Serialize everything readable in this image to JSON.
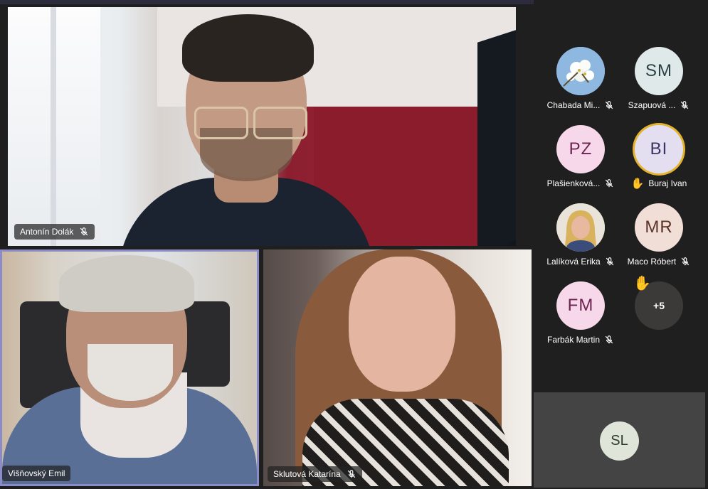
{
  "participants_main": [
    {
      "name": "Antonín Dolák",
      "muted": true
    },
    {
      "name": "Višňovský Emil",
      "muted": false
    },
    {
      "name": "Sklutová Katarína",
      "muted": true
    }
  ],
  "gallery": [
    {
      "initials": "",
      "name": "Chabada Mi...",
      "muted": true,
      "avatar_type": "flower",
      "color": "#9fc6e9"
    },
    {
      "initials": "SM",
      "name": "Szapuová ...",
      "muted": true,
      "color": "#dfe9ea",
      "text_color": "#2b4148"
    },
    {
      "initials": "PZ",
      "name": "Plašienková...",
      "muted": true,
      "color": "#f7d8ea",
      "text_color": "#6b2450"
    },
    {
      "initials": "BI",
      "name": "Buraj Ivan",
      "muted": false,
      "hand_raised": true,
      "speaking": true,
      "color": "#e3dff0",
      "text_color": "#3b3361"
    },
    {
      "initials": "",
      "name": "Lalíková Erika",
      "muted": true,
      "avatar_type": "photo",
      "color": "#d6c9b8"
    },
    {
      "initials": "MR",
      "name": "Maco Róbert",
      "muted": true,
      "color": "#f1ded7",
      "text_color": "#5b3427"
    },
    {
      "initials": "FM",
      "name": "Farbák Martin",
      "muted": true,
      "color": "#f7d8ea",
      "text_color": "#6b2450"
    }
  ],
  "more": {
    "label": "+5",
    "hand_raised": true
  },
  "self": {
    "initials": "SL"
  },
  "colors": {
    "background": "#1f1f1f",
    "active_border": "#8b8cc7",
    "speaking_ring": "#e3b32c"
  }
}
